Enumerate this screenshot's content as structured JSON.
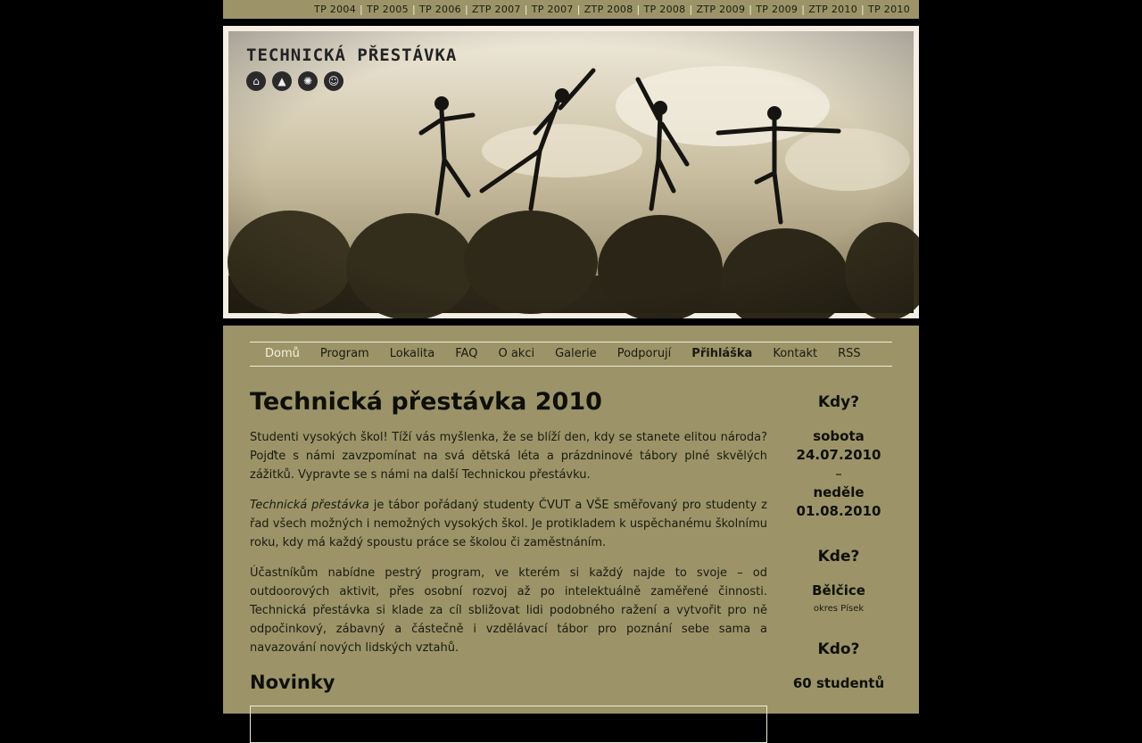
{
  "yearbar": {
    "links": [
      "TP 2004",
      "TP 2005",
      "TP 2006",
      "ZTP 2007",
      "TP 2007",
      "ZTP 2008",
      "TP 2008",
      "ZTP 2009",
      "TP 2009",
      "ZTP 2010",
      "TP 2010"
    ]
  },
  "header": {
    "logo_text": "Technická přestávka",
    "icons": [
      "home-icon",
      "tree-icon",
      "sun-icon",
      "people-icon"
    ]
  },
  "nav": {
    "items": [
      "Domů",
      "Program",
      "Lokalita",
      "FAQ",
      "O akci",
      "Galerie",
      "Podporují",
      "Přihláška",
      "Kontakt",
      "RSS"
    ],
    "active": "Domů",
    "bold": "Přihláška"
  },
  "main": {
    "title": "Technická přestávka 2010",
    "p1": "Studenti vysokých škol! Tíží vás myšlenka, že se blíží den, kdy se stanete elitou národa? Pojďte s námi zavzpomínat na svá dětská léta a prázdninové tábory plné skvělých zážitků. Vypravte se s námi na další Technickou přestávku.",
    "p2_em": "Technická přestávka",
    "p2_rest": " je tábor pořádaný studenty ČVUT a VŠE směřovaný pro studenty z řad všech možných i nemožných vysokých škol. Je protikladem k uspěchanému školnímu roku, kdy má každý spoustu práce se školou či zaměstnáním.",
    "p3": "Účastníkům nabídne pestrý program, ve kterém si každý najde to svoje – od outdoorových aktivit, přes osobní rozvoj až po intelektuálně zaměřené činnosti. Technická přestávka si klade za cíl sbližovat lidi podobného ražení a vytvořit pro ně odpočinkový, zábavný a částečně i vzdělávací tábor pro poznání sebe sama a navazování nových lidských vztahů.",
    "news_heading": "Novinky"
  },
  "side": {
    "when_heading": "Kdy?",
    "when_day1": "sobota",
    "when_date1": "24.07.2010",
    "when_dash": "–",
    "when_day2": "neděle",
    "when_date2": "01.08.2010",
    "where_heading": "Kde?",
    "where_place": "Bělčice",
    "where_district": "okres Písek",
    "who_heading": "Kdo?",
    "who_count": "60 studentů"
  },
  "colors": {
    "background": "#000000",
    "panel": "#9c9468",
    "nav_active": "#f4f0dc",
    "text": "#1b1a10"
  }
}
